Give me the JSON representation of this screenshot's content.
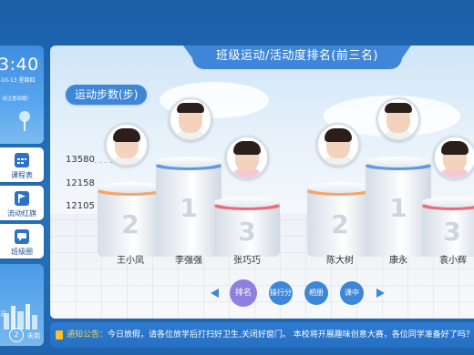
{
  "clock": {
    "time": "3:40",
    "date": "-10-13 星期四",
    "tip": "请注意保暖!"
  },
  "nav": [
    {
      "label": "课程表",
      "icon": "calendar-icon"
    },
    {
      "label": "流动红旗",
      "icon": "flag-icon"
    },
    {
      "label": "班级圈",
      "icon": "chat-icon"
    }
  ],
  "weather": {
    "left_text": "况",
    "count": "2",
    "count_label": "未到"
  },
  "panel": {
    "title": "班级运动/活动度排名(前三名)",
    "metric_label": "运动步数(步)"
  },
  "chart_data": {
    "type": "bar",
    "yticks": [
      "13580",
      "12158",
      "12105"
    ],
    "podiums": [
      {
        "group": "left",
        "names": [
          "王小凤",
          "李强强",
          "张巧巧"
        ],
        "places": [
          "2",
          "1",
          "3"
        ],
        "values": [
          13580,
          12158,
          12105
        ]
      },
      {
        "group": "right",
        "names": [
          "陈大树",
          "康永",
          "袁小辉"
        ],
        "places": [
          "2",
          "1",
          "3"
        ]
      }
    ]
  },
  "buttons": [
    {
      "label": "排名",
      "active": true
    },
    {
      "label": "操行分",
      "active": false
    },
    {
      "label": "相册",
      "active": false
    },
    {
      "label": "课中",
      "active": false
    }
  ],
  "notice": {
    "label": "通知公告：",
    "text": "今日放假，请各位放学后打扫好卫生,关闭好窗门。 本校将开展趣味创意大赛，各位同学准备好了吗？"
  },
  "colors": {
    "accent": "#3e86d8",
    "silver": "#f4a66b",
    "gold": "#5b9be3",
    "bronze": "#ef6a78",
    "active_pill": "#8f7fe0"
  }
}
